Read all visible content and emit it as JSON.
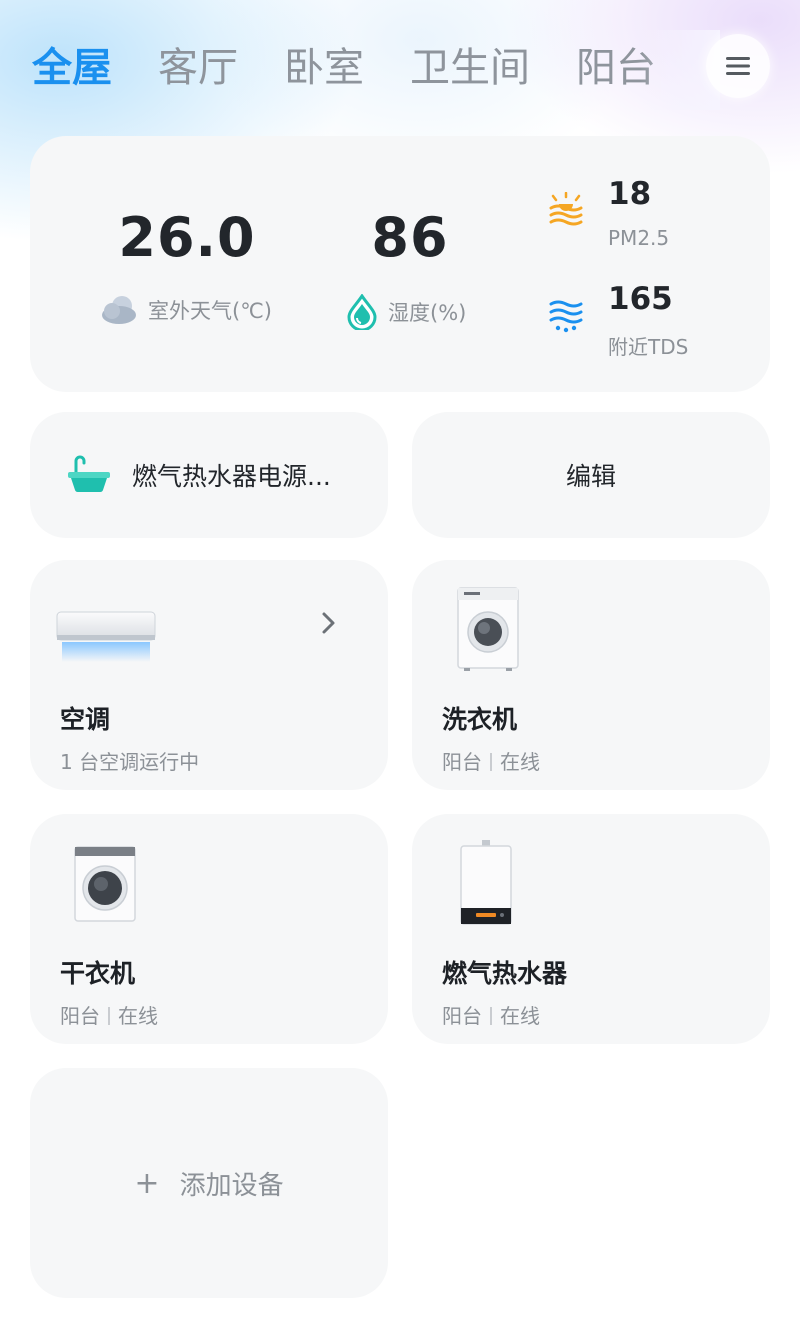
{
  "tabs": [
    {
      "label": "全屋",
      "active": true
    },
    {
      "label": "客厅",
      "active": false
    },
    {
      "label": "卧室",
      "active": false
    },
    {
      "label": "卫生间",
      "active": false
    },
    {
      "label": "阳台",
      "active": false
    }
  ],
  "menu_icon": "hamburger-menu-icon",
  "environment": {
    "temperature": {
      "value": "26.0",
      "label": "室外天气(℃)",
      "icon": "cloud-icon"
    },
    "humidity": {
      "value": "86",
      "label": "湿度(%)",
      "icon": "water-drop-icon"
    },
    "pm25": {
      "value": "18",
      "label": "PM2.5",
      "icon": "air-wave-icon"
    },
    "tds": {
      "value": "165",
      "label": "附近TDS",
      "icon": "water-wave-icon"
    }
  },
  "scene": {
    "label": "燃气热水器电源...",
    "icon": "bathtub-icon"
  },
  "edit": {
    "label": "编辑"
  },
  "devices": [
    {
      "name": "空调",
      "status": "1 台空调运行中",
      "icon": "air-conditioner-icon"
    },
    {
      "name": "洗衣机",
      "room": "阳台",
      "state": "在线",
      "icon": "washing-machine-icon"
    },
    {
      "name": "干衣机",
      "room": "阳台",
      "state": "在线",
      "icon": "dryer-icon"
    },
    {
      "name": "燃气热水器",
      "room": "阳台",
      "state": "在线",
      "icon": "water-heater-icon"
    }
  ],
  "add_device": {
    "label": "添加设备",
    "icon": "plus-icon"
  },
  "colors": {
    "accent": "#1a90ef",
    "text": "#22262b",
    "muted": "#8c9197",
    "card": "#f6f7f8",
    "teal": "#1fbfae",
    "orange": "#f5a623"
  }
}
